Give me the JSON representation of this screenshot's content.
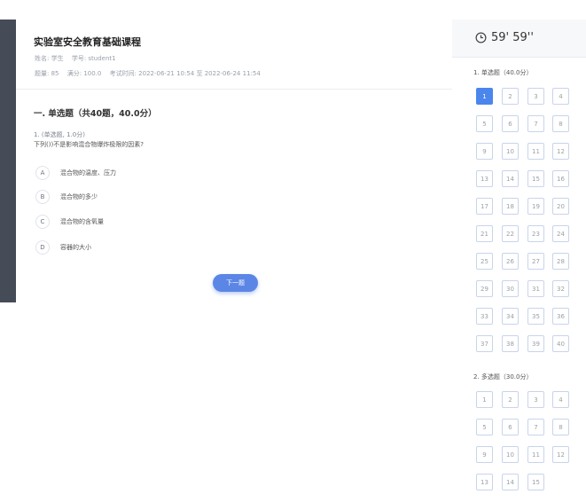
{
  "course": {
    "title": "实验室安全教育基础课程",
    "name_label": "姓名: 学生",
    "student_id": "学号: student1",
    "count": "题量: 85",
    "full_score": "满分: 100.0",
    "exam_time": "考试时间: 2022-06-21 10:54 至 2022-06-24 11:54"
  },
  "section": {
    "title": "一. 单选题（共40题，40.0分）"
  },
  "question": {
    "type": "1. (单选题, 1.0分)",
    "text": "下列())不是影响混合物爆炸极限的因素?",
    "options": [
      {
        "letter": "A",
        "text": "混合物的温度、压力"
      },
      {
        "letter": "B",
        "text": "混合物的多少"
      },
      {
        "letter": "C",
        "text": "混合物的含氧量"
      },
      {
        "letter": "D",
        "text": "容器的大小"
      }
    ]
  },
  "next_button": "下一题",
  "timer": {
    "text": "59' 59''",
    "icon": "clock-icon"
  },
  "groups": [
    {
      "title": "1. 单选题（40.0分）",
      "count": 40,
      "active": 1
    },
    {
      "title": "2. 多选题（30.0分）",
      "count": 15,
      "active": 0
    }
  ],
  "colors": {
    "accent": "#4a86ec",
    "button": "#5b86e5",
    "sidebar": "#454b57"
  }
}
